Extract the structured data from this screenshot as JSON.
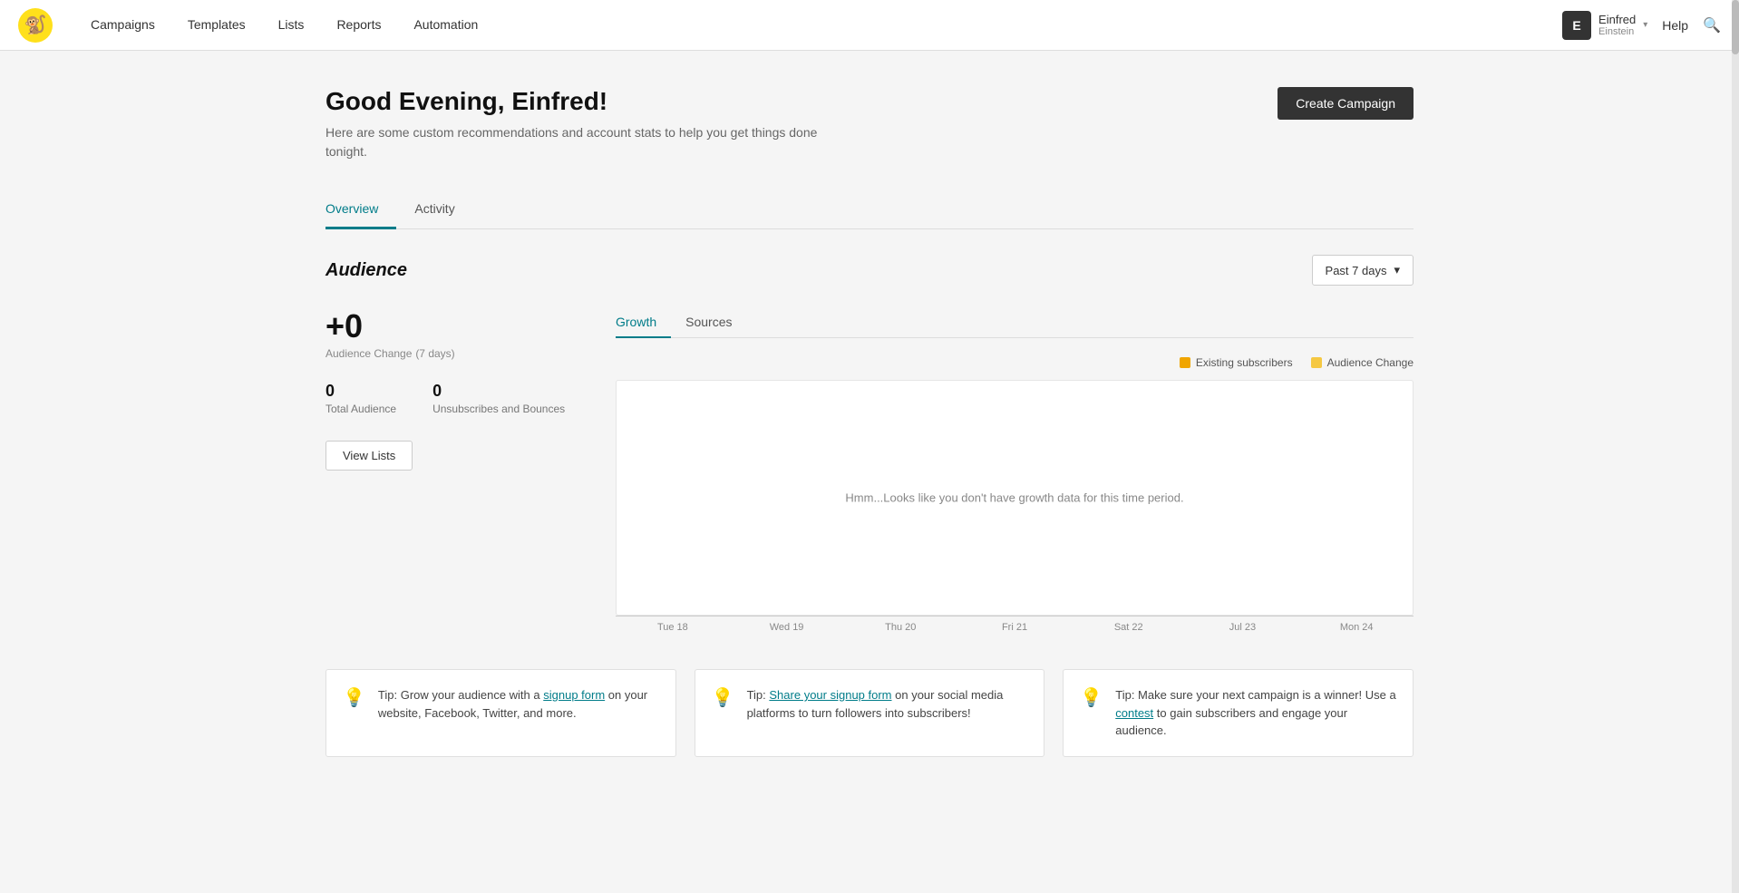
{
  "nav": {
    "logo_emoji": "🐒",
    "links": [
      "Campaigns",
      "Templates",
      "Lists",
      "Reports",
      "Automation"
    ],
    "user": {
      "initials": "E",
      "name": "Einfred",
      "subtitle": "Einstein",
      "chevron": "▾"
    },
    "help": "Help",
    "search_icon": "🔍"
  },
  "header": {
    "greeting": "Good Evening, Einfred!",
    "subtitle_line1": "Here are some custom recommendations and account stats to help you get things done",
    "subtitle_line2": "tonight.",
    "create_campaign_label": "Create Campaign"
  },
  "tabs": {
    "items": [
      "Overview",
      "Activity"
    ],
    "active": "Overview"
  },
  "audience": {
    "title": "Audience",
    "period_label": "Past 7 days",
    "period_chevron": "▾",
    "change_value": "+0",
    "change_label": "Audience Change",
    "change_period": "(7 days)",
    "total_audience": "0",
    "total_audience_label": "Total Audience",
    "unsubscribes": "0",
    "unsubscribes_label": "Unsubscribes and Bounces",
    "view_lists_label": "View Lists",
    "chart_tabs": [
      "Growth",
      "Sources"
    ],
    "chart_active_tab": "Growth",
    "legend": [
      {
        "label": "Existing subscribers",
        "color": "#f0a500"
      },
      {
        "label": "Audience Change",
        "color": "#f5c842"
      }
    ],
    "chart_empty_msg": "Hmm...Looks like you don't have growth data for this time period.",
    "x_labels": [
      "Tue 18",
      "Wed 19",
      "Thu 20",
      "Fri 21",
      "Sat 22",
      "Jul 23",
      "Mon 24"
    ]
  },
  "tips": [
    {
      "icon": "💡",
      "text_before": "Tip: Grow your audience with a ",
      "link_text": "signup form",
      "text_after": " on your website, Facebook, Twitter, and more."
    },
    {
      "icon": "💡",
      "text_before": "Tip: ",
      "link_text": "Share your signup form",
      "text_after": " on your social media platforms to turn followers into subscribers!"
    },
    {
      "icon": "💡",
      "text_before": "Tip: Make sure your next campaign is a winner! Use a ",
      "link_text": "contest",
      "text_after": " to gain subscribers and engage your audience."
    }
  ]
}
